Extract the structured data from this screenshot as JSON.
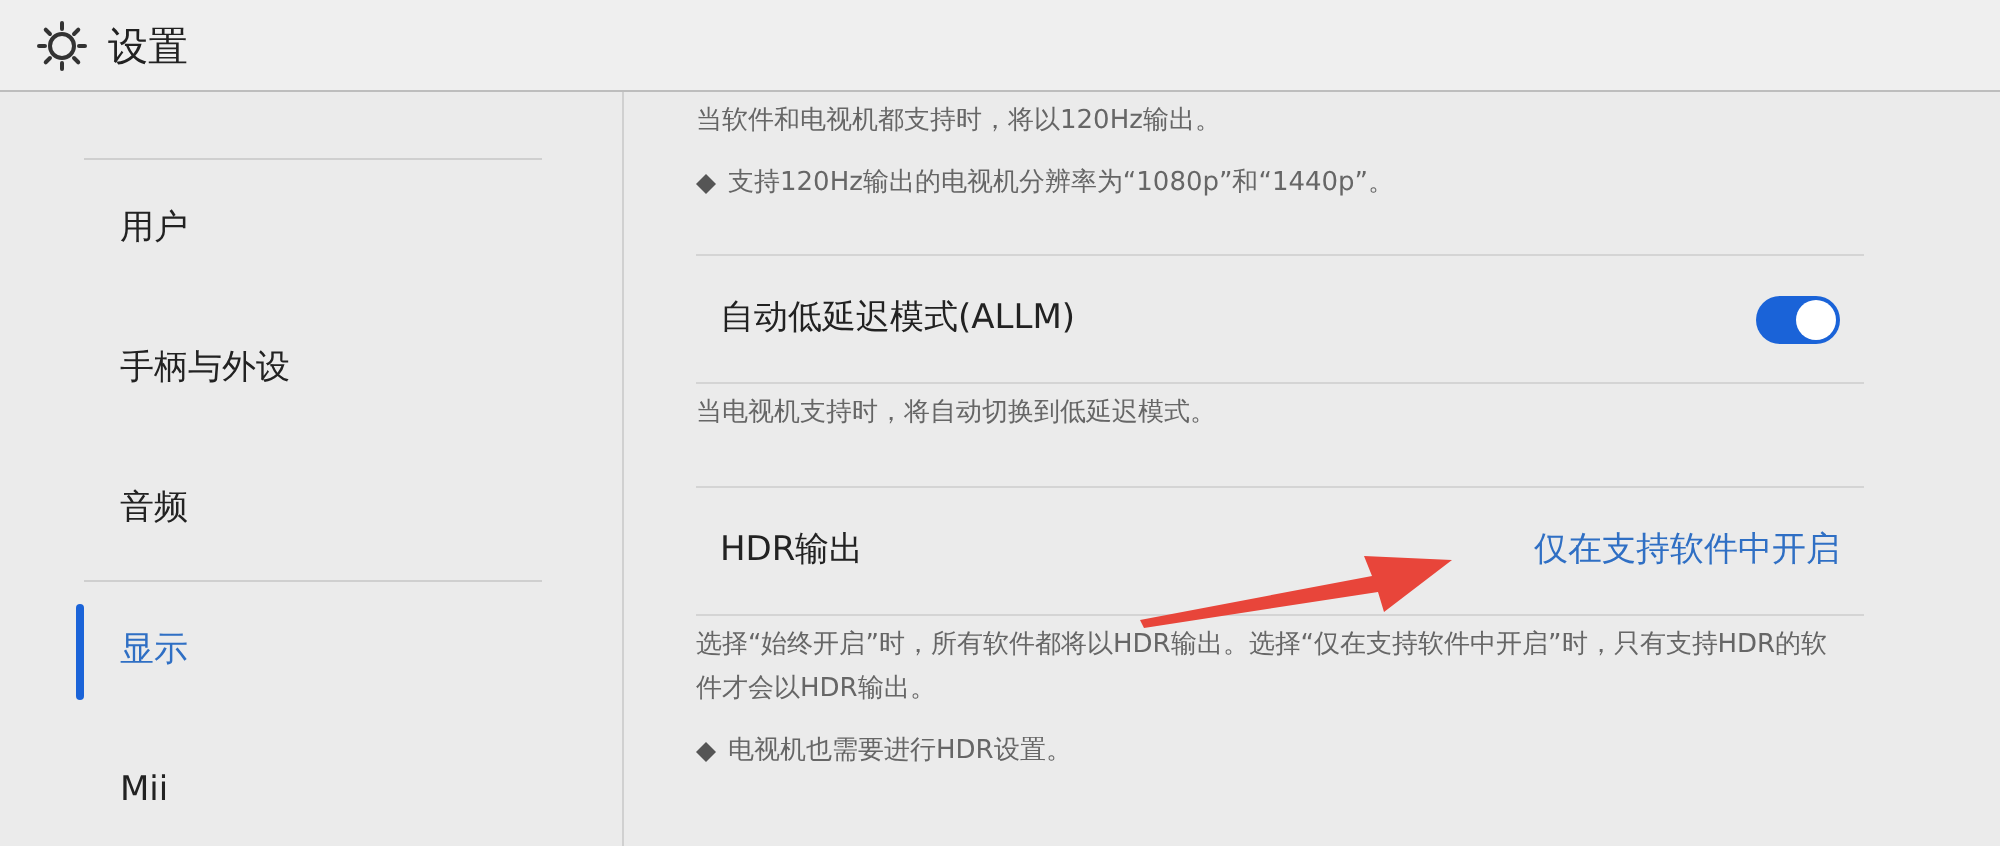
{
  "header": {
    "title": "设置"
  },
  "sidebar": {
    "groups": [
      {
        "items": [
          {
            "label": "用户",
            "selected": false
          },
          {
            "label": "手柄与外设",
            "selected": false
          },
          {
            "label": "音频",
            "selected": false
          }
        ]
      },
      {
        "items": [
          {
            "label": "显示",
            "selected": true
          },
          {
            "label": "Mii",
            "selected": false
          }
        ]
      }
    ]
  },
  "content": {
    "blocks": [
      {
        "kind": "note",
        "text": "当软件和电视机都支持时，将以120Hz输出。"
      },
      {
        "kind": "bullet",
        "text": "支持120Hz输出的电视机分辨率为“1080p”和“1440p”。"
      },
      {
        "kind": "toggle",
        "label": "自动低延迟模式(ALLM)",
        "on": true
      },
      {
        "kind": "note",
        "text": "当电视机支持时，将自动切换到低延迟模式。"
      },
      {
        "kind": "choice",
        "label": "HDR输出",
        "value": "仅在支持软件中开启"
      },
      {
        "kind": "note",
        "text": "选择“始终开启”时，所有软件都将以HDR输出。选择“仅在支持软件中开启”时，只有支持HDR的软件才会以HDR输出。"
      },
      {
        "kind": "bullet",
        "text": "电视机也需要进行HDR设置。"
      }
    ]
  }
}
